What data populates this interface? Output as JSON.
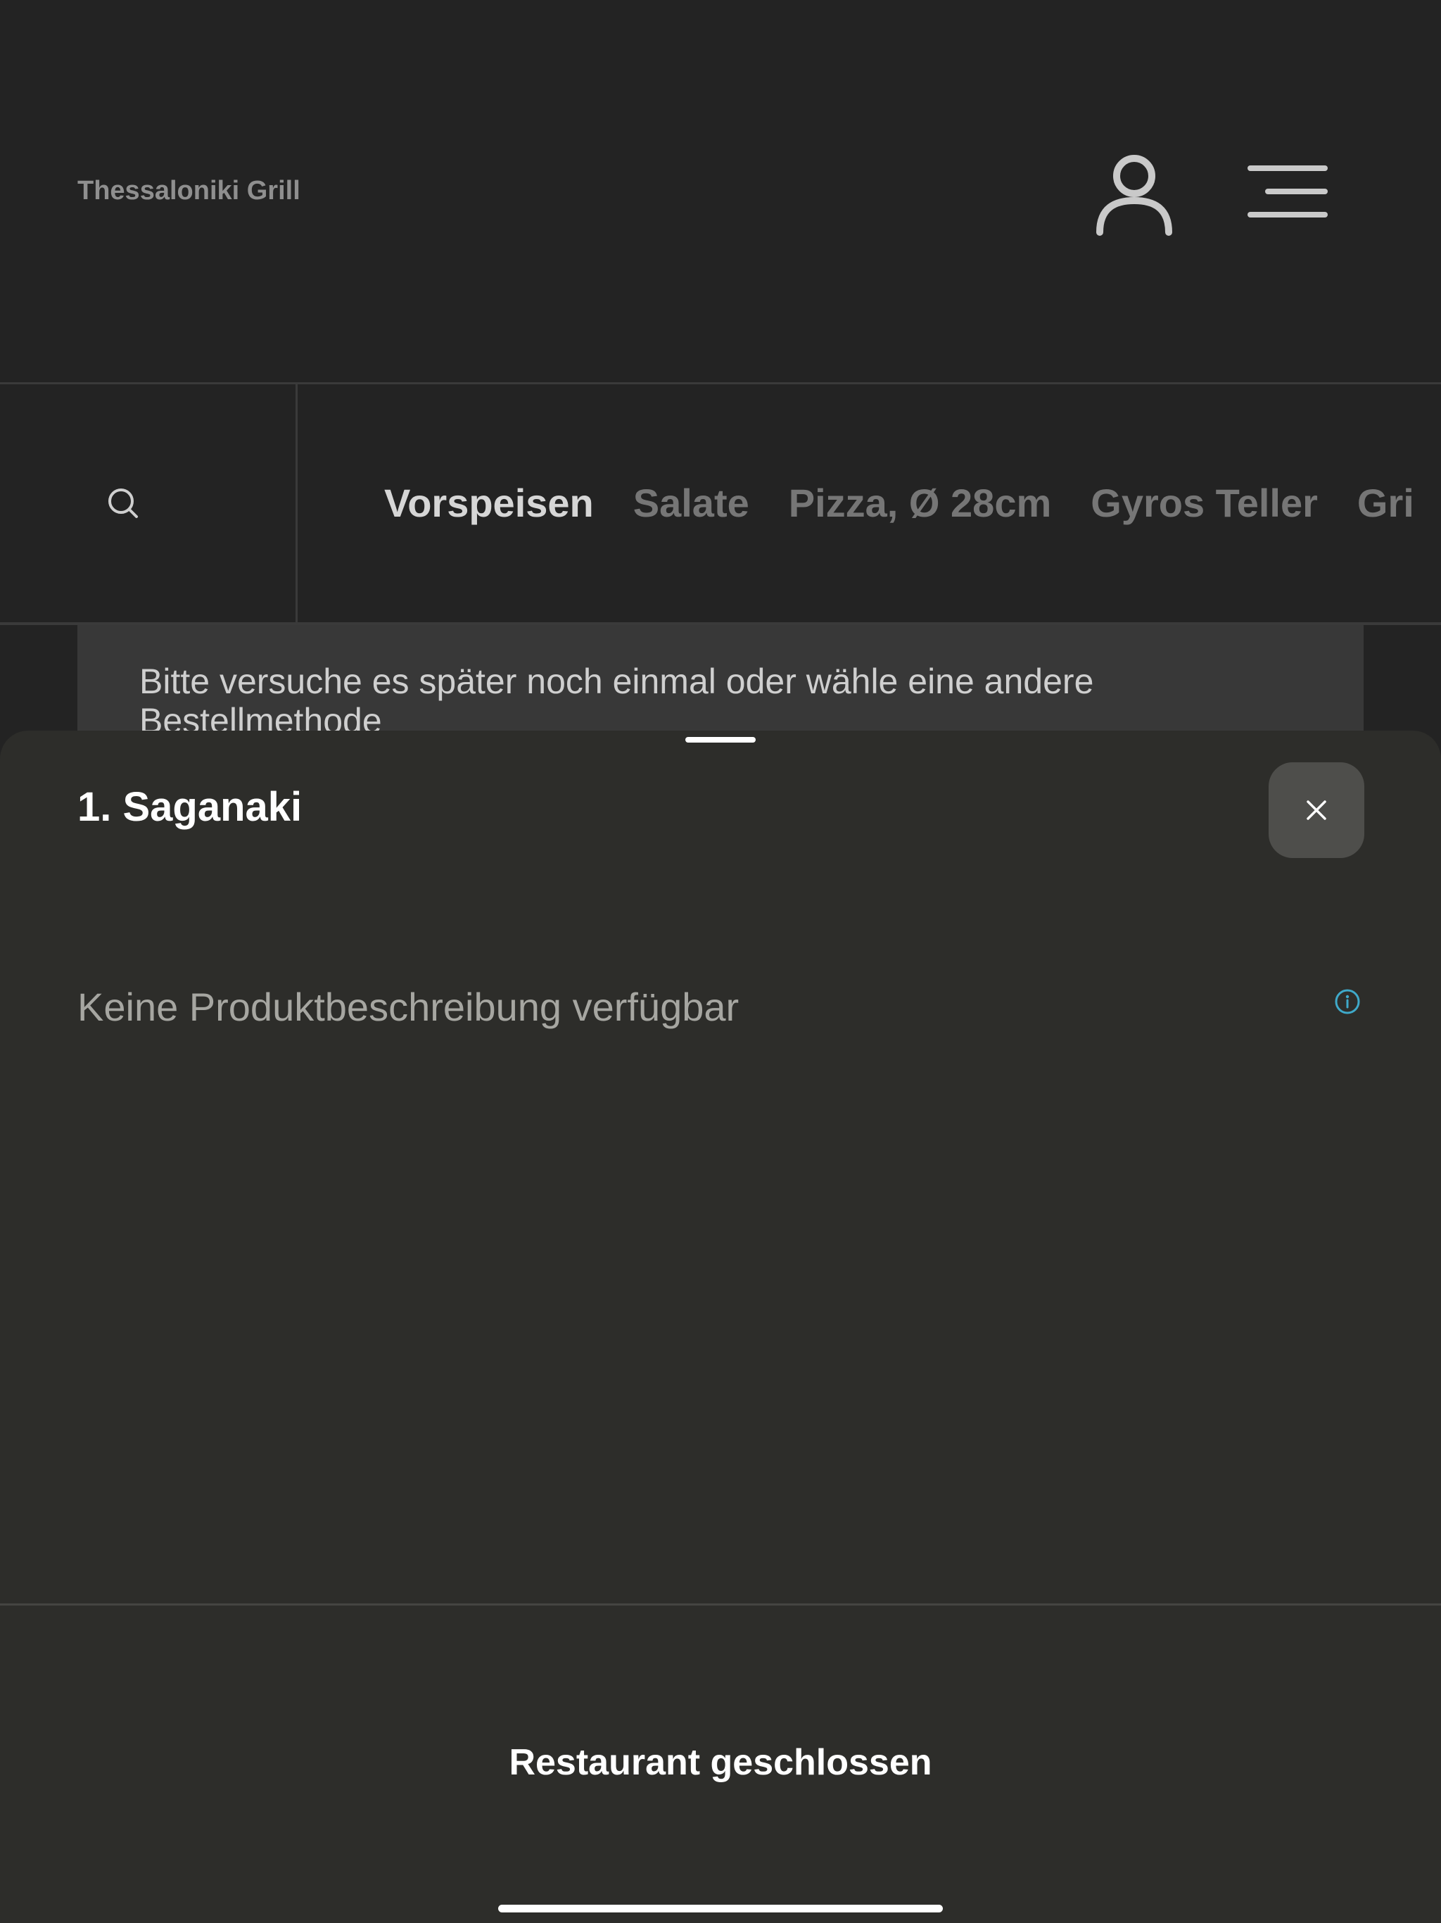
{
  "header": {
    "restaurant_name": "Thessaloniki Grill",
    "account_icon": "person-icon",
    "menu_icon": "hamburger-menu-icon"
  },
  "category_nav": {
    "search_icon": "search-icon",
    "tabs": [
      {
        "label": "Vorspeisen",
        "active": true
      },
      {
        "label": "Salate",
        "active": false
      },
      {
        "label": "Pizza, Ø 28cm",
        "active": false
      },
      {
        "label": "Gyros Teller",
        "active": false
      },
      {
        "label": "Gri",
        "active": false
      }
    ]
  },
  "notice": {
    "text": "Bitte versuche es später noch einmal oder wähle eine andere Bestellmethode"
  },
  "product_sheet": {
    "title": "1. Saganaki",
    "close_icon": "close-icon",
    "description": "Keine Produktbeschreibung verfügbar",
    "info_icon": "info-icon",
    "info_color": "#3fa9c9",
    "footer_status": "Restaurant geschlossen"
  }
}
